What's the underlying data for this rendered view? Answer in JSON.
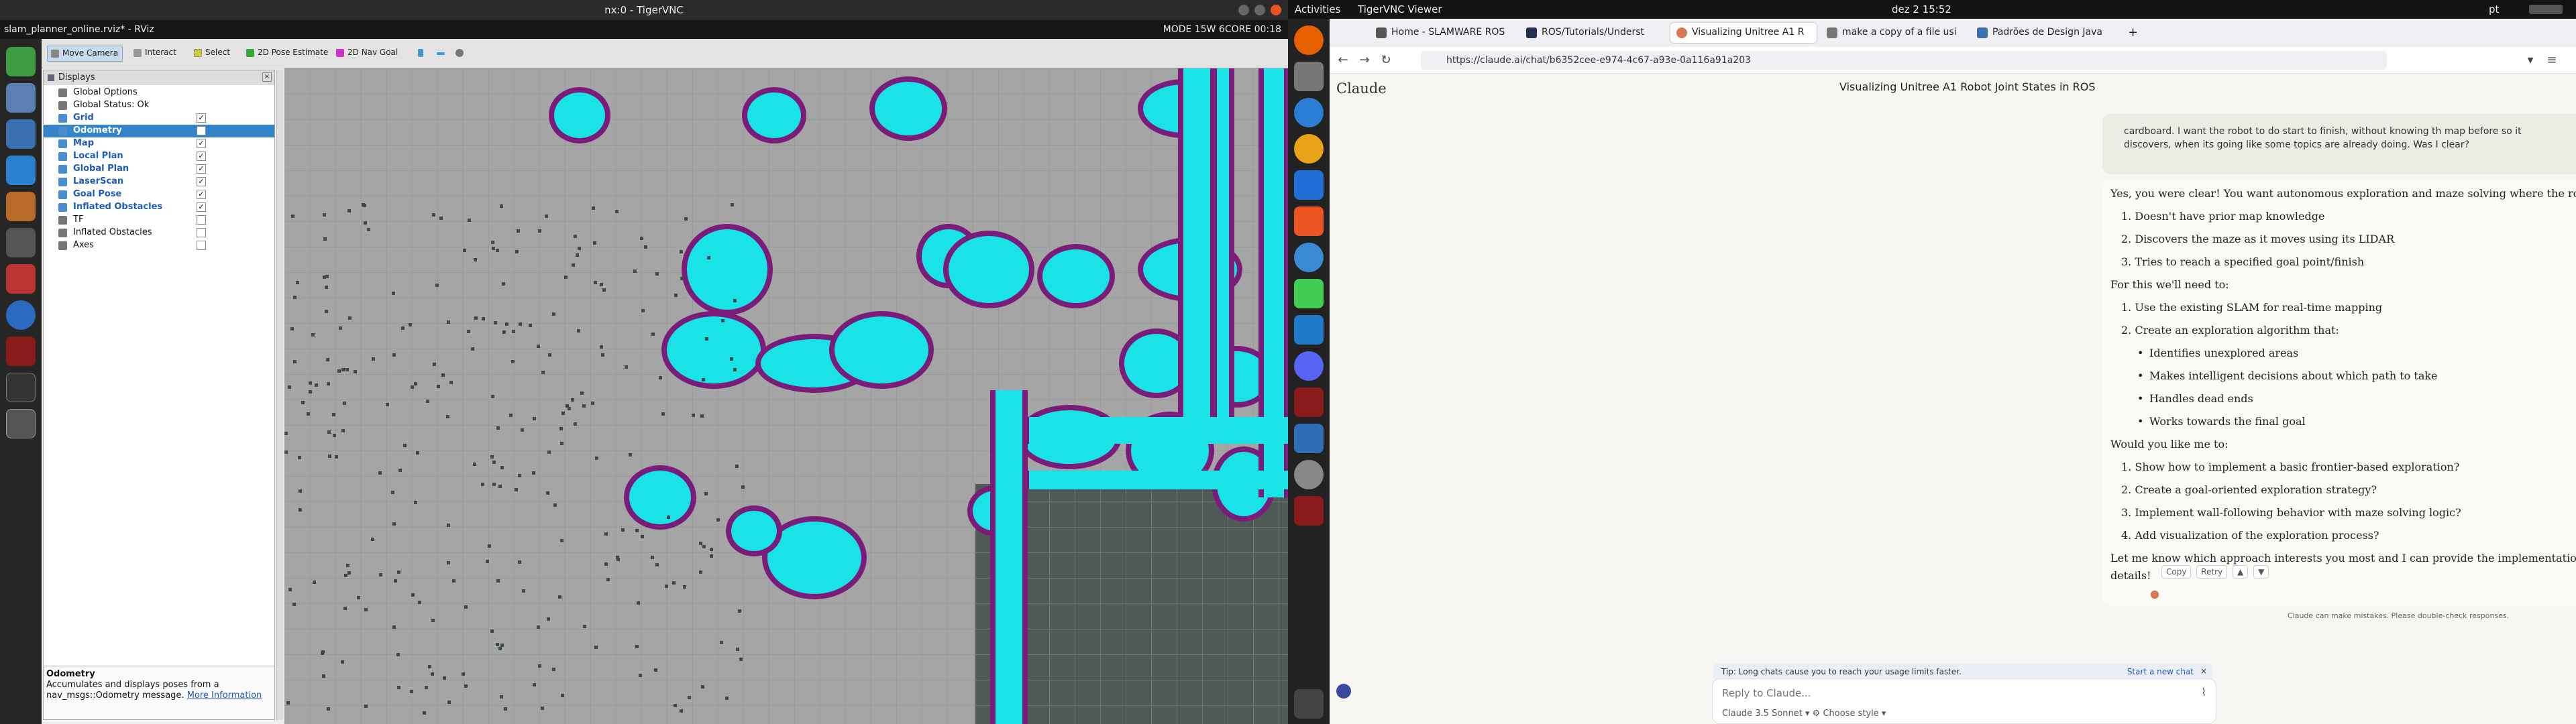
{
  "vnc": {
    "window_title": "nx:0 - TigerVNC",
    "remote_window": "slam_planner_online.rviz* - RViz",
    "status_text": "MODE 15W 6CORE",
    "clock": "00:18"
  },
  "rviz": {
    "toolbar": [
      "Move Camera",
      "Interact",
      "Select",
      "2D Pose Estimate",
      "2D Nav Goal"
    ],
    "displays_title": "Displays",
    "display_items": [
      {
        "label": "Global Options",
        "checked": false,
        "style": "normal",
        "icon": "gear-icon"
      },
      {
        "label": "Global Status: Ok",
        "checked": false,
        "style": "normal",
        "icon": "check-icon"
      },
      {
        "label": "Grid",
        "checked": true,
        "style": "blue",
        "icon": "grid-icon"
      },
      {
        "label": "Odometry",
        "checked": true,
        "style": "selected",
        "icon": "arrow-icon"
      },
      {
        "label": "Map",
        "checked": true,
        "style": "blue",
        "icon": "map-icon"
      },
      {
        "label": "Local Plan",
        "checked": true,
        "style": "blue",
        "icon": "path-icon"
      },
      {
        "label": "Global Plan",
        "checked": true,
        "style": "blue",
        "icon": "path-icon"
      },
      {
        "label": "LaserScan",
        "checked": true,
        "style": "blue",
        "icon": "laser-icon"
      },
      {
        "label": "Goal Pose",
        "checked": true,
        "style": "blue",
        "icon": "pose-icon"
      },
      {
        "label": "Inflated Obstacles",
        "checked": true,
        "style": "blue",
        "icon": "map-icon"
      },
      {
        "label": "TF",
        "checked": false,
        "style": "normal",
        "icon": "tf-icon"
      },
      {
        "label": "Inflated Obstacles",
        "checked": false,
        "style": "normal",
        "icon": "map-icon"
      },
      {
        "label": "Axes",
        "checked": false,
        "style": "normal",
        "icon": "axes-icon"
      }
    ],
    "description": {
      "title": "Odometry",
      "text": "Accumulates and displays poses from a nav_msgs::Odometry message.",
      "link": "More Information"
    }
  },
  "ubuntu": {
    "activities": "Activities",
    "app_menu": "TigerVNC Viewer",
    "datetime": "dez 2  15:52",
    "lang": "pt"
  },
  "browser": {
    "tabs": [
      "Home - SLAMWARE ROS",
      "ROS/Tutorials/Underst",
      "Visualizing Unitree A1 R",
      "make a copy of a file usi",
      "Padrões de Design Java"
    ],
    "active_tab": 2,
    "url": "https://claude.ai/chat/b6352cee-e974-4c67-a93e-0a116a91a203"
  },
  "claude": {
    "brand": "Claude",
    "conversation_title": "Visualizing Unitree A1 Robot Joint States in ROS",
    "user_msg": [
      "cardboard. I want the robot to do start to finish, without knowing th map before so it",
      "discovers, when its going like some topics are already doing. Was I clear?"
    ],
    "answer": {
      "intro": "Yes, you were clear! You want autonomous exploration and maze solving where the robot:",
      "goals": [
        "Doesn't have prior map knowledge",
        "Discovers the maze as it moves using its LIDAR",
        "Tries to reach a specified goal point/finish"
      ],
      "need_title": "For this we'll need to:",
      "need": [
        "Use the existing SLAM for real-time mapping",
        "Create an exploration algorithm that:"
      ],
      "bullets": [
        "Identifies unexplored areas",
        "Makes intelligent decisions about which path to take",
        "Handles dead ends",
        "Works towards the final goal"
      ],
      "ask": "Would you like me to:",
      "options": [
        "Show how to implement a basic frontier-based exploration?",
        "Create a goal-oriented exploration strategy?",
        "Implement wall-following behavior with maze solving logic?",
        "Add visualization of the exploration process?"
      ],
      "closing_1": "Let me know which approach interests you most and I can provide the implementation",
      "closing_2": "details!"
    },
    "actions": [
      "Copy",
      "Retry"
    ],
    "disclaimer": "Claude can make mistakes. Please double-check responses.",
    "tip": "Tip: Long chats cause you to reach your usage limits faster.",
    "new_chat": "Start a new chat",
    "reply_placeholder": "Reply to Claude...",
    "model": "Claude 3.5 Sonnet",
    "style": "Choose style"
  }
}
